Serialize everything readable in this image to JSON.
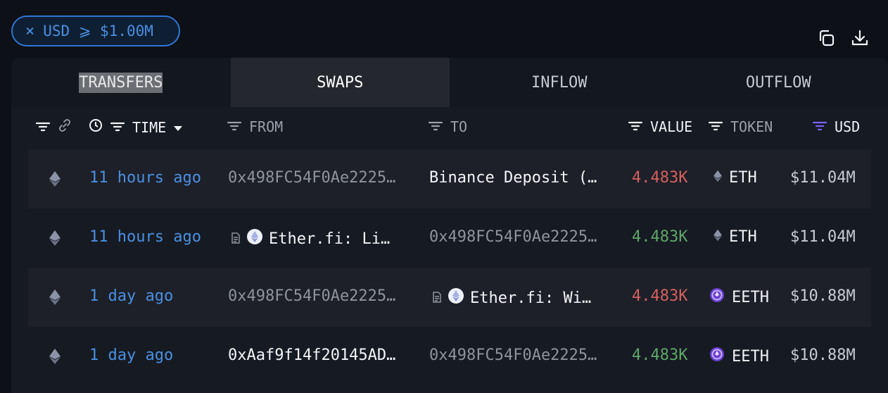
{
  "filter": {
    "close_icon": "close-icon",
    "label": "USD ⩾ $1.00M"
  },
  "toolbar": {
    "copy_icon": "copy-icon",
    "download_icon": "download-icon"
  },
  "tabs": [
    {
      "label": "TRANSFERS"
    },
    {
      "label": "SWAPS"
    },
    {
      "label": "INFLOW"
    },
    {
      "label": "OUTFLOW"
    }
  ],
  "columns": {
    "time": "TIME",
    "from": "FROM",
    "to": "TO",
    "value": "VALUE",
    "token": "TOKEN",
    "usd": "USD"
  },
  "colors": {
    "accent": "#4a90e2",
    "positive": "#5fa66a",
    "negative": "#d46060",
    "usd_filter_active": "#7b61ff"
  },
  "rows": [
    {
      "time": "11 hours ago",
      "from": "0x498FC54F0Ae2225…",
      "to": "Binance Deposit (…",
      "value": "4.483K",
      "value_color": "red",
      "token": "ETH",
      "usd": "$11.04M"
    },
    {
      "time": "11 hours ago",
      "from": "Ether.fi: Li…",
      "to": "0x498FC54F0Ae2225…",
      "value": "4.483K",
      "value_color": "green",
      "token": "ETH",
      "usd": "$11.04M"
    },
    {
      "time": "1 day ago",
      "from": "0x498FC54F0Ae2225…",
      "to": "Ether.fi: Wi…",
      "value": "4.483K",
      "value_color": "red",
      "token": "EETH",
      "usd": "$10.88M"
    },
    {
      "time": "1 day ago",
      "from": "0xAaf9f14f20145AD…",
      "to": "0x498FC54F0Ae2225…",
      "value": "4.483K",
      "value_color": "green",
      "token": "EETH",
      "usd": "$10.88M"
    }
  ]
}
